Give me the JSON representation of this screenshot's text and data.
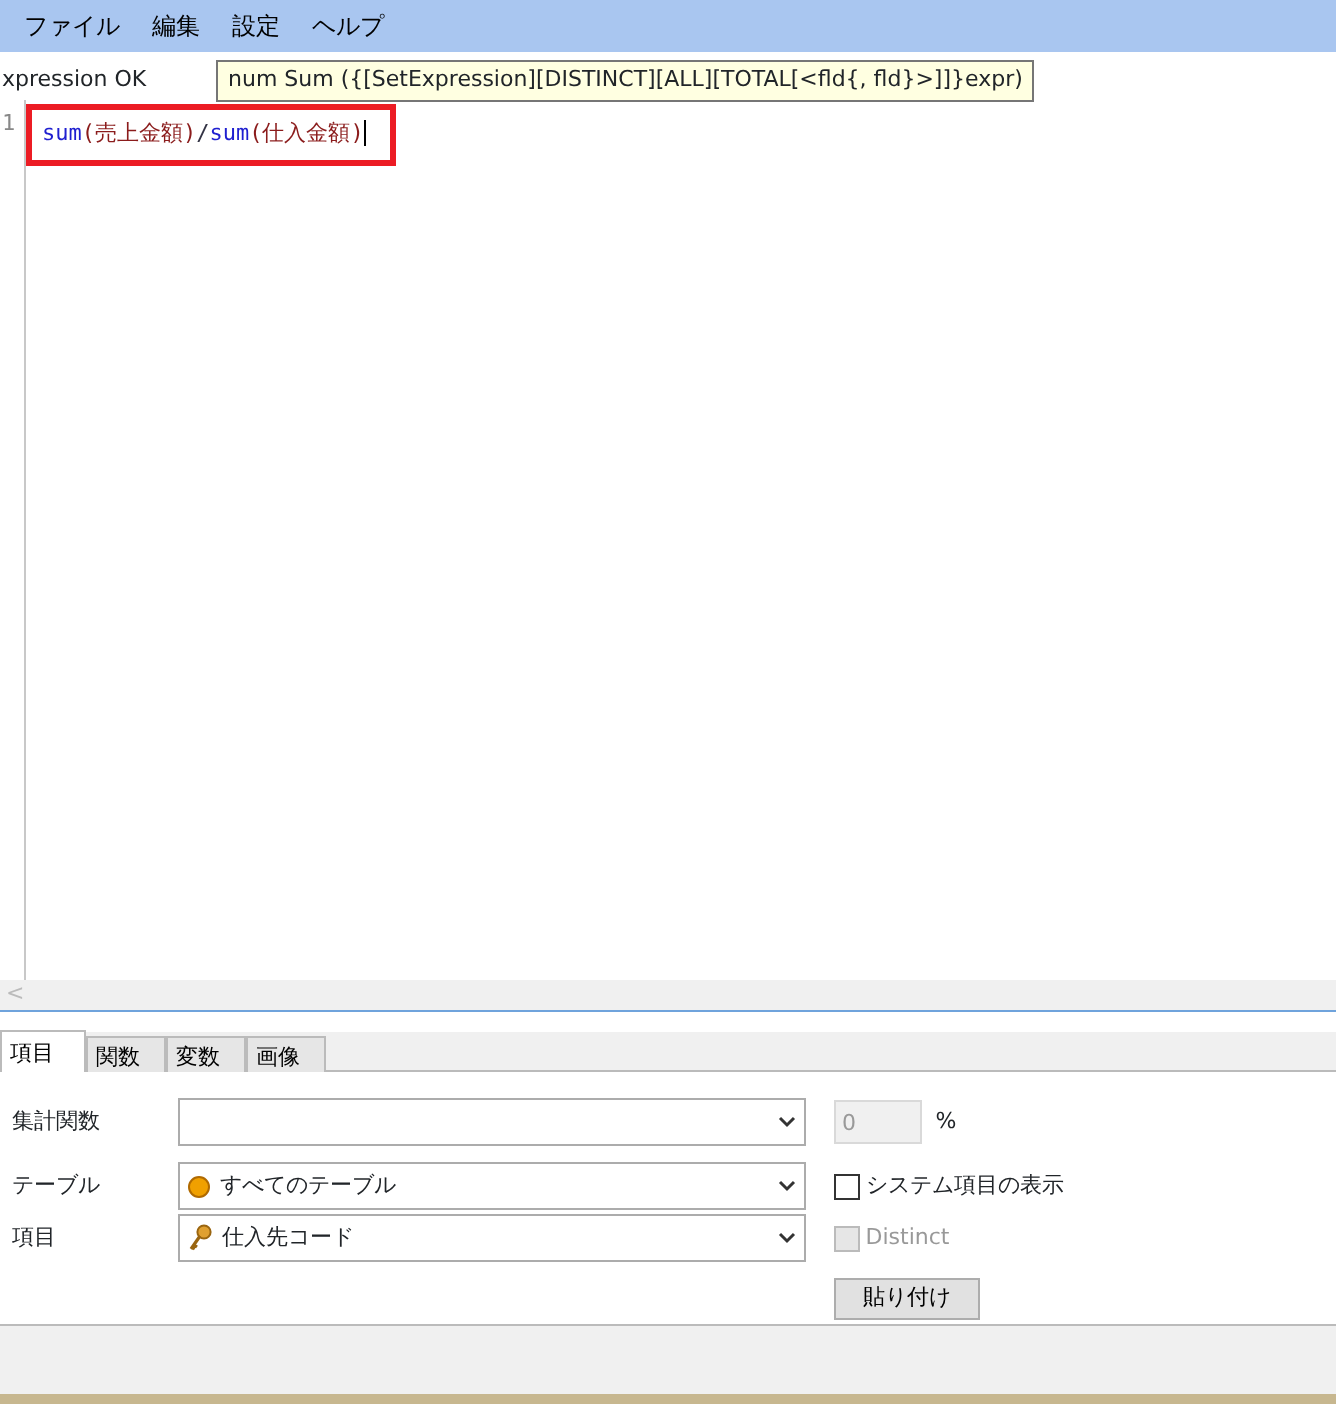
{
  "menu": [
    "ファイル",
    "編集",
    "設定",
    "ヘルプ"
  ],
  "status": "xpression OK",
  "tooltip": "num Sum ({[SetExpression][DISTINCT][ALL][TOTAL[<fld{, fld}>]]}expr)",
  "editor": {
    "line_number": "1",
    "highlighted": true,
    "tokens": [
      {
        "kind": "function",
        "text": "sum"
      },
      {
        "kind": "field",
        "text": "(売上金額)"
      },
      {
        "kind": "operator",
        "text": "/"
      },
      {
        "kind": "function",
        "text": "sum"
      },
      {
        "kind": "field",
        "text": "(仕入金額)"
      }
    ]
  },
  "scroll_arrow": "<",
  "tabs": [
    {
      "label": "項目",
      "selected": true
    },
    {
      "label": "関数",
      "selected": false
    },
    {
      "label": "変数",
      "selected": false
    },
    {
      "label": "画像",
      "selected": false
    }
  ],
  "form": {
    "aggregate": {
      "label": "集計関数"
    },
    "percent": {
      "value": "0",
      "unit": "%",
      "disabled": true
    },
    "table": {
      "label": "テーブル",
      "value": "すべてのテーブル"
    },
    "show_system": {
      "label": "システム項目の表示",
      "checked": false,
      "disabled": false
    },
    "field": {
      "label": "項目",
      "value": "仕入先コード"
    },
    "distinct": {
      "label": "Distinct",
      "checked": false,
      "disabled": true
    },
    "paste_button": "貼り付け"
  }
}
